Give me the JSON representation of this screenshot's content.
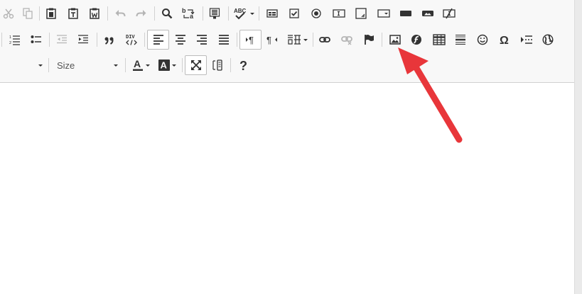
{
  "toolbar": {
    "row1": [
      {
        "name": "cut-button",
        "icon": "scissors-icon",
        "disabled": true
      },
      {
        "name": "copy-button",
        "icon": "copy-icon",
        "disabled": true
      },
      {
        "name": "paste-button",
        "icon": "clipboard-icon",
        "disabled": false
      },
      {
        "name": "paste-text-button",
        "icon": "clipboard-text-icon",
        "disabled": false
      },
      {
        "name": "paste-word-button",
        "icon": "clipboard-word-icon",
        "disabled": false
      },
      {
        "name": "undo-button",
        "icon": "undo-icon",
        "disabled": true
      },
      {
        "name": "redo-button",
        "icon": "redo-icon",
        "disabled": true
      },
      {
        "name": "find-button",
        "icon": "magnifier-icon",
        "disabled": false
      },
      {
        "name": "replace-button",
        "icon": "replace-icon",
        "disabled": false
      },
      {
        "name": "select-all-button",
        "icon": "select-all-icon",
        "disabled": false
      },
      {
        "name": "spellcheck-button",
        "icon": "spellcheck-icon",
        "label": "ABC",
        "disabled": false
      },
      {
        "name": "form-button",
        "icon": "form-icon",
        "disabled": false
      },
      {
        "name": "checkbox-button",
        "icon": "checkbox-icon",
        "disabled": false
      },
      {
        "name": "radio-button",
        "icon": "radio-icon",
        "disabled": false
      },
      {
        "name": "text-field-button",
        "icon": "text-field-icon",
        "disabled": false
      },
      {
        "name": "textarea-button",
        "icon": "textarea-icon",
        "disabled": false
      },
      {
        "name": "select-field-button",
        "icon": "select-field-icon",
        "disabled": false
      },
      {
        "name": "form-button-button",
        "icon": "button-icon",
        "disabled": false
      },
      {
        "name": "image-button-button",
        "icon": "image-button-icon",
        "disabled": false
      },
      {
        "name": "hidden-field-button",
        "icon": "hidden-field-icon",
        "disabled": false
      }
    ],
    "row2": [
      {
        "name": "numbered-list-button",
        "icon": "numbered-list-icon"
      },
      {
        "name": "bulleted-list-button",
        "icon": "bulleted-list-icon"
      },
      {
        "name": "decrease-indent-button",
        "icon": "outdent-icon",
        "disabled": true
      },
      {
        "name": "increase-indent-button",
        "icon": "indent-icon"
      },
      {
        "name": "blockquote-button",
        "icon": "quote-icon"
      },
      {
        "name": "create-div-button",
        "icon": "div-icon",
        "label": "DIV"
      },
      {
        "name": "align-left-button",
        "icon": "align-left-icon",
        "active": true
      },
      {
        "name": "align-center-button",
        "icon": "align-center-icon"
      },
      {
        "name": "align-right-button",
        "icon": "align-right-icon"
      },
      {
        "name": "justify-button",
        "icon": "justify-icon"
      },
      {
        "name": "ltr-button",
        "icon": "ltr-icon",
        "active": true
      },
      {
        "name": "rtl-button",
        "icon": "rtl-icon"
      },
      {
        "name": "language-button",
        "icon": "language-icon"
      },
      {
        "name": "link-button",
        "icon": "link-icon"
      },
      {
        "name": "unlink-button",
        "icon": "unlink-icon",
        "disabled": true
      },
      {
        "name": "anchor-button",
        "icon": "flag-icon"
      },
      {
        "name": "image-button",
        "icon": "image-icon"
      },
      {
        "name": "flash-button",
        "icon": "flash-icon"
      },
      {
        "name": "table-button",
        "icon": "table-icon"
      },
      {
        "name": "horizontal-line-button",
        "icon": "horizontal-line-icon"
      },
      {
        "name": "smiley-button",
        "icon": "smiley-icon"
      },
      {
        "name": "special-char-button",
        "icon": "omega-icon",
        "label": "Ω"
      },
      {
        "name": "page-break-button",
        "icon": "page-break-icon"
      },
      {
        "name": "iframe-button",
        "icon": "globe-icon"
      }
    ],
    "row3": {
      "format_combo_value": "",
      "size_combo_label": "Size",
      "buttons": [
        {
          "name": "text-color-button",
          "icon": "text-color-icon",
          "label": "A"
        },
        {
          "name": "background-color-button",
          "icon": "background-color-icon",
          "label": "A"
        },
        {
          "name": "maximize-button",
          "icon": "maximize-icon",
          "active": true
        },
        {
          "name": "show-blocks-button",
          "icon": "show-blocks-icon"
        },
        {
          "name": "about-button",
          "icon": "help-icon",
          "label": "?"
        }
      ]
    }
  },
  "annotation": {
    "icon": "red-arrow-icon",
    "color": "#e8363a"
  },
  "colors": {
    "toolbar_bg": "#f8f8f8",
    "icon": "#333333",
    "icon_disabled": "#b5b5b5",
    "arrow": "#e8363a"
  }
}
